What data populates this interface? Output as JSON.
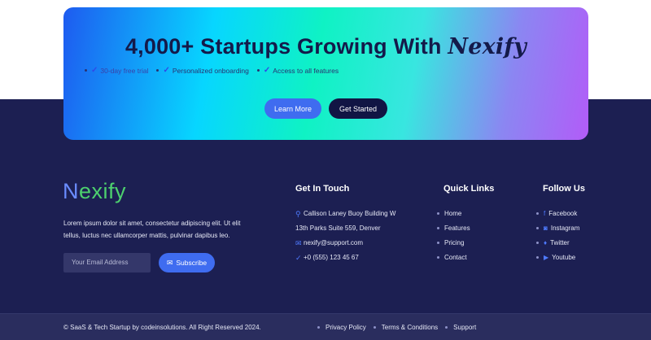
{
  "cta": {
    "title": "4,000+ Startups Growing With",
    "brand": "Nexify",
    "features": [
      {
        "label": "30-day free trial",
        "highlight": true
      },
      {
        "label": "Personalized onboarding",
        "highlight": false
      },
      {
        "label": "Access to all features",
        "highlight": false
      }
    ],
    "learn_more": "Learn More",
    "get_started": "Get Started"
  },
  "footer": {
    "logo_initial": "N",
    "logo_rest": "exify",
    "about": "Lorem ipsum dolor sit amet, consectetur adipiscing elit. Ut elit tellus, luctus nec ullamcorper mattis, pulvinar dapibus leo.",
    "email_placeholder": "Your Email Address",
    "subscribe": "Subscribe",
    "contact": {
      "title": "Get In Touch",
      "address_line1": "Callison Laney Buoy Building W",
      "address_line2": "13th Parks Suite 559, Denver",
      "email": "nexify@support.com",
      "phone": "+0 (555) 123 45 67"
    },
    "quick_links": {
      "title": "Quick Links",
      "items": [
        "Home",
        "Features",
        "Pricing",
        "Contact"
      ]
    },
    "follow": {
      "title": "Follow Us",
      "items": [
        {
          "label": "Facebook",
          "icon": "facebook-icon"
        },
        {
          "label": "Instagram",
          "icon": "instagram-icon"
        },
        {
          "label": "Twitter",
          "icon": "twitter-icon"
        },
        {
          "label": "Youtube",
          "icon": "youtube-icon"
        }
      ]
    }
  },
  "bottom": {
    "copyright": "© SaaS & Tech Startup by codeinsolutions. All Right Reserved 2024.",
    "links": [
      "Privacy Policy",
      "Terms & Conditions",
      "Support"
    ]
  },
  "colors": {
    "footer_bg": "#1c1f52",
    "accent": "#3f6cf0",
    "dark_button": "#111544",
    "logo_green": "#4dd06e"
  }
}
